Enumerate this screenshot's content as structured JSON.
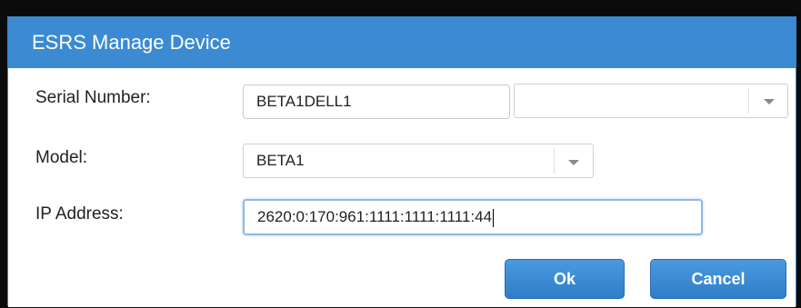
{
  "dialog": {
    "title": "ESRS Manage Device"
  },
  "form": {
    "serial_number": {
      "label": "Serial Number:",
      "value": "BETA1DELL1",
      "secondary_value": ""
    },
    "model": {
      "label": "Model:",
      "value": "BETA1"
    },
    "ip_address": {
      "label": "IP Address:",
      "value": "2620:0:170:961:1111:1111:1111:44"
    }
  },
  "buttons": {
    "ok": "Ok",
    "cancel": "Cancel"
  },
  "icons": {
    "dropdown": "chevron-down-icon"
  },
  "colors": {
    "titlebar": "#3b8ad2",
    "button": "#3a89d6",
    "frame": "#0b0b0b"
  }
}
